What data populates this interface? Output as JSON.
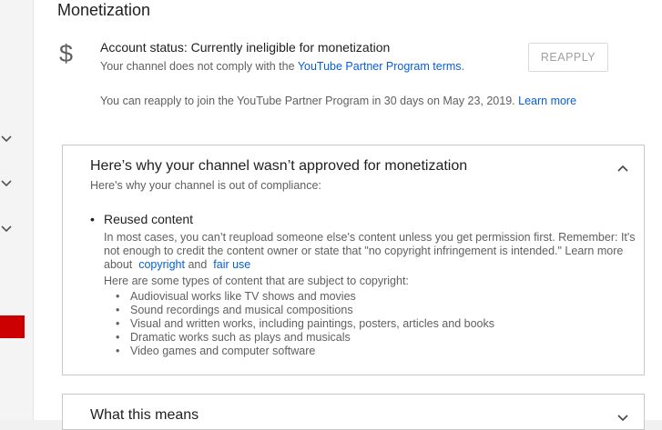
{
  "page": {
    "title": "Monetization"
  },
  "status": {
    "icon": "dollar-icon",
    "icon_glyph": "$",
    "account_status": "Account status: Currently ineligible for monetization",
    "sub_prefix": "Your channel does not comply with the ",
    "sub_link": "YouTube Partner Program terms",
    "sub_suffix": ".",
    "reapply_label": "REAPPLY",
    "reapply_info": "You can reapply to join the YouTube Partner Program in 30 days on May 23, 2019.",
    "learn_more": "Learn more"
  },
  "card_reasons": {
    "title": "Here’s why your channel wasn’t approved for monetization",
    "subtitle": "Here's why your channel is out of compliance:",
    "reason_title": "Reused content",
    "reason_desc": "In most cases, you can’t reupload someone else's content unless you get permission first. Remember: It's not enough to credit the content owner or state that \"no copyright infringement is intended.\" Learn more about",
    "link_copyright": "copyright",
    "link_and": "and",
    "link_fair_use": "fair use",
    "types_intro": "Here are some types of content that are subject to copyright:",
    "types": [
      "Audiovisual works like TV shows and movies",
      "Sound recordings and musical compositions",
      "Visual and written works, including paintings, posters, articles and books",
      "Dramatic works such as plays and musicals",
      "Video games and computer software"
    ]
  },
  "card_meaning": {
    "title": "What this means"
  },
  "colors": {
    "link": "#065fd4",
    "accent_red": "#cc0000",
    "text_primary": "#212121",
    "text_secondary": "#606060"
  }
}
